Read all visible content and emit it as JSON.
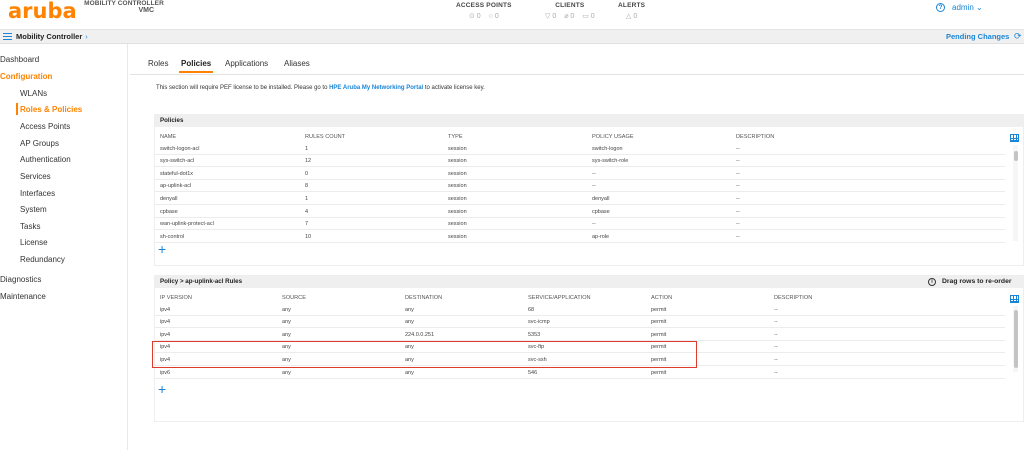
{
  "header": {
    "logo": "aruba",
    "product_line1": "MOBILITY CONTROLLER",
    "product_line2": "VMC",
    "groups": [
      {
        "label": "ACCESS POINTS",
        "values": [
          "⊙ 0",
          "○ 0"
        ]
      },
      {
        "label": "CLIENTS",
        "values": [
          "▽ 0",
          "⌀ 0",
          "▭ 0"
        ]
      },
      {
        "label": "ALERTS",
        "values": [
          "△ 0"
        ]
      }
    ],
    "help_glyph": "?",
    "user": "admin ⌄"
  },
  "crumbbar": {
    "title": "Mobility Controller",
    "chevron": "›",
    "pending": "Pending Changes",
    "refresh_glyph": "⟳"
  },
  "sidebar": {
    "items": [
      {
        "label": "Dashboard",
        "level": "top"
      },
      {
        "label": "Configuration",
        "level": "top-active"
      },
      {
        "label": "WLANs",
        "level": "sub"
      },
      {
        "label": "Roles & Policies",
        "level": "sub-active"
      },
      {
        "label": "Access Points",
        "level": "sub"
      },
      {
        "label": "AP Groups",
        "level": "sub"
      },
      {
        "label": "Authentication",
        "level": "sub"
      },
      {
        "label": "Services",
        "level": "sub"
      },
      {
        "label": "Interfaces",
        "level": "sub"
      },
      {
        "label": "System",
        "level": "sub"
      },
      {
        "label": "Tasks",
        "level": "sub"
      },
      {
        "label": "License",
        "level": "sub"
      },
      {
        "label": "Redundancy",
        "level": "sub"
      },
      {
        "label": "Diagnostics",
        "level": "top"
      },
      {
        "label": "Maintenance",
        "level": "top"
      }
    ]
  },
  "tabs": [
    {
      "label": "Roles",
      "active": false
    },
    {
      "label": "Policies",
      "active": true
    },
    {
      "label": "Applications",
      "active": false
    },
    {
      "label": "Aliases",
      "active": false
    }
  ],
  "notice": {
    "prefix": "This section will require PEF license to be installed. Please go to ",
    "link": "HPE Aruba My Networking Portal",
    "suffix": " to activate license key."
  },
  "policies": {
    "title": "Policies",
    "columns": [
      "NAME",
      "RULES COUNT",
      "TYPE",
      "POLICY USAGE",
      "DESCRIPTION"
    ],
    "rows": [
      [
        "switch-logon-acl",
        "1",
        "session",
        "switch-logon",
        "--"
      ],
      [
        "sys-switch-acl",
        "12",
        "session",
        "sys-switch-role",
        "--"
      ],
      [
        "stateful-dot1x",
        "0",
        "session",
        "--",
        "--"
      ],
      [
        "ap-uplink-acl",
        "8",
        "session",
        "--",
        "--"
      ],
      [
        "denyall",
        "1",
        "session",
        "denyall",
        "--"
      ],
      [
        "cpbase",
        "4",
        "session",
        "cpbase",
        "--"
      ],
      [
        "wan-uplink-protect-acl",
        "7",
        "session",
        "--",
        "--"
      ],
      [
        "sh-control",
        "10",
        "session",
        "ap-role",
        "--"
      ]
    ],
    "add_glyph": "+"
  },
  "rules": {
    "title": "Policy > ap-uplink-acl Rules",
    "drag_hint": "Drag rows to re-order",
    "info_glyph": "i",
    "columns": [
      "IP VERSION",
      "SOURCE",
      "DESTINATION",
      "SERVICE/APPLICATION",
      "ACTION",
      "DESCRIPTION"
    ],
    "rows": [
      [
        "ipv4",
        "any",
        "any",
        "68",
        "permit",
        "--"
      ],
      [
        "ipv4",
        "any",
        "any",
        "svc-icmp",
        "permit",
        "--"
      ],
      [
        "ipv4",
        "any",
        "224.0.0.251",
        "5353",
        "permit",
        "--"
      ],
      [
        "ipv4",
        "any",
        "any",
        "svc-ftp",
        "permit",
        "--"
      ],
      [
        "ipv4",
        "any",
        "any",
        "svc-ssh",
        "permit",
        "--"
      ],
      [
        "ipv6",
        "any",
        "any",
        "546",
        "permit",
        "--"
      ]
    ],
    "highlighted_rows": [
      3,
      4
    ],
    "add_glyph": "+"
  },
  "colors": {
    "brand_orange": "#ff8300",
    "link_blue": "#1a85d6",
    "highlight_red": "#e03a2f"
  }
}
